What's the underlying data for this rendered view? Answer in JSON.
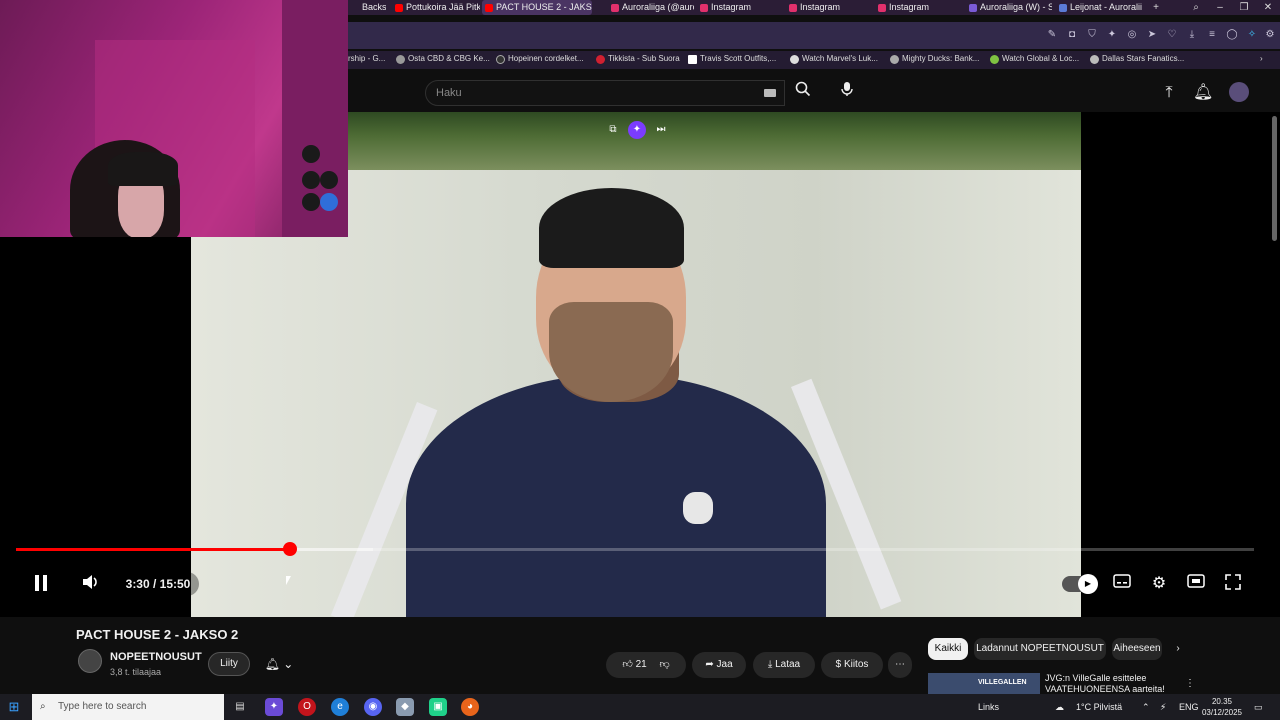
{
  "browser": {
    "tabs": [
      {
        "label": "Backstal",
        "color": "#888888"
      },
      {
        "label": "Pottukoira Jää Pitkä",
        "color": "#ff0000"
      },
      {
        "label": "PACT HOUSE 2 - JAKS",
        "color": "#ff0000"
      },
      {
        "label": "Auroraliiga (@auro",
        "color": "#e1306c"
      },
      {
        "label": "Instagram",
        "color": "#e1306c"
      },
      {
        "label": "Instagram",
        "color": "#e1306c"
      },
      {
        "label": "Instagram",
        "color": "#e1306c"
      },
      {
        "label": "Auroraliiga (W) - St",
        "color": "#7a5bd6"
      },
      {
        "label": "Leijonat - Auroralii",
        "color": "#5b7bd6"
      }
    ],
    "bookmarks": [
      {
        "label": "rship - G...",
        "color": "#888888"
      },
      {
        "label": "Osta CBD & CBG Ke...",
        "color": "#999999"
      },
      {
        "label": "Hopeinen cordelket...",
        "color": "#333333"
      },
      {
        "label": "Tikkista - Sub Suora",
        "color": "#d02030"
      },
      {
        "label": "Travis Scott Outfits,...",
        "color": "#ffffff"
      },
      {
        "label": "Watch Marvel's Luk...",
        "color": "#dddddd"
      },
      {
        "label": "Mighty Ducks: Bank...",
        "color": "#aaaaaa"
      },
      {
        "label": "Watch Global & Loc...",
        "color": "#7fc242"
      },
      {
        "label": "Dallas Stars Fanatics...",
        "color": "#bbbbbb"
      }
    ]
  },
  "masthead": {
    "search_placeholder": "Haku"
  },
  "player": {
    "time": "3:30 / 15:50",
    "progress_fraction": 0.221,
    "buffered_fraction": 0.288
  },
  "video_info": {
    "title": "PACT HOUSE 2 - JAKSO 2",
    "channel": "NOPEETNOUSUT",
    "subscribers": "3,8 t. tilaajaa",
    "join": "Liity",
    "likes": "21",
    "share": "Jaa",
    "download": "Lataa",
    "thanks": "Kiitos"
  },
  "chips": [
    "Kaikki",
    "Ladannut NOPEETNOUSUT",
    "Aiheeseen"
  ],
  "recommendation": {
    "thumb_text": "VILLEGALLEN",
    "title": "JVG:n VilleGalle esittelee VAATEHUONEENSA aarteita!"
  },
  "taskbar": {
    "search_placeholder": "Type here to search",
    "links": "Links",
    "weather": "1°C Pilvistä",
    "lang": "ENG",
    "time": "20.35",
    "date": "03/12/2025"
  },
  "colors": {
    "accent": "#ff0000",
    "browser_frame": "#2b1d36"
  }
}
